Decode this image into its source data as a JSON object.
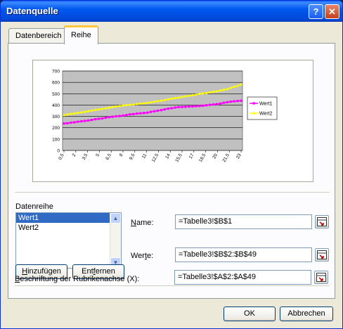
{
  "window": {
    "title": "Datenquelle",
    "help_glyph": "?",
    "close_glyph": "✕"
  },
  "tabs": [
    {
      "label": "Datenbereich"
    },
    {
      "label": "Reihe"
    }
  ],
  "chart_data": {
    "type": "line",
    "title": "",
    "xlabel": "",
    "ylabel": "",
    "ylim": [
      0,
      700
    ],
    "y_ticks": [
      0,
      100,
      200,
      300,
      400,
      500,
      600,
      700
    ],
    "x_tick_labels": [
      "0,5",
      "2",
      "3,5",
      "5",
      "6,5",
      "8",
      "9,5",
      "11",
      "12,5",
      "14",
      "15,5",
      "17",
      "18,5",
      "20",
      "21,5",
      "23"
    ],
    "legend_position": "right",
    "grid": true,
    "series": [
      {
        "name": "Wert1",
        "color": "#ff00ff",
        "values": [
          238,
          240,
          245,
          248,
          253,
          257,
          260,
          264,
          269,
          275,
          279,
          282,
          288,
          293,
          297,
          301,
          303,
          307,
          312,
          318,
          320,
          325,
          327,
          330,
          333,
          340,
          345,
          350,
          355,
          362,
          368,
          372,
          378,
          382,
          383,
          385,
          387,
          388,
          390,
          392,
          394,
          398,
          402,
          405,
          408,
          413,
          420,
          425,
          430,
          433,
          436,
          438
        ]
      },
      {
        "name": "Wert2",
        "color": "#ffff00",
        "values": [
          312,
          318,
          323,
          327,
          332,
          337,
          341,
          347,
          352,
          358,
          362,
          367,
          372,
          378,
          383,
          388,
          392,
          397,
          400,
          403,
          405,
          410,
          413,
          417,
          420,
          425,
          430,
          435,
          440,
          445,
          452,
          457,
          462,
          467,
          472,
          478,
          482,
          488,
          492,
          500,
          503,
          507,
          512,
          518,
          522,
          528,
          535,
          540,
          552,
          562,
          570,
          583
        ]
      }
    ]
  },
  "series_section": {
    "label": "Datenreihe",
    "items": [
      {
        "label": "Wert1"
      },
      {
        "label": "Wert2"
      }
    ],
    "add_button": {
      "pre": "",
      "key": "H",
      "post": "inzufügen"
    },
    "remove_button": {
      "pre": "Ent",
      "key": "f",
      "post": "ernen"
    },
    "name_label": {
      "pre": "",
      "key": "N",
      "post": "ame:"
    },
    "name_value": "=Tabelle3!$B$1",
    "values_label": {
      "pre": "Wer",
      "key": "t",
      "post": "e:"
    },
    "values_value": "=Tabelle3!$B$2:$B$49"
  },
  "category_axis": {
    "label": {
      "pre": "",
      "key": "B",
      "post": "eschriftung der Rubrikenachse (X):"
    },
    "value": "=Tabelle3!$A$2:$A$49"
  },
  "footer": {
    "ok_label": "OK",
    "cancel_label": "Abbrechen"
  }
}
